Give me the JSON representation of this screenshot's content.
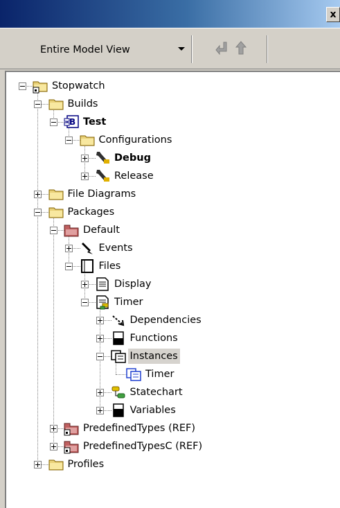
{
  "window": {
    "close_glyph": "x"
  },
  "toolbar": {
    "view_label": "Entire Model View",
    "back_icon": "arrow-down-left-icon",
    "up_icon": "arrow-up-icon"
  },
  "tree": [
    {
      "label": "Stopwatch",
      "icon": "project-folder-icon"
    },
    {
      "label": "Builds",
      "icon": "folder-icon"
    },
    {
      "label": "Test",
      "icon": "build-component-icon",
      "bold": true
    },
    {
      "label": "Configurations",
      "icon": "folder-icon"
    },
    {
      "label": "Debug",
      "icon": "wrench-icon",
      "bold": true
    },
    {
      "label": "Release",
      "icon": "wrench-icon"
    },
    {
      "label": "File Diagrams",
      "icon": "folder-icon"
    },
    {
      "label": "Packages",
      "icon": "folder-icon"
    },
    {
      "label": "Default",
      "icon": "package-icon"
    },
    {
      "label": "Events",
      "icon": "event-icon"
    },
    {
      "label": "Files",
      "icon": "file-list-icon"
    },
    {
      "label": "Display",
      "icon": "file-icon"
    },
    {
      "label": "Timer",
      "icon": "file-with-statechart-icon"
    },
    {
      "label": "Dependencies",
      "icon": "dependency-icon"
    },
    {
      "label": "Functions",
      "icon": "operations-icon"
    },
    {
      "label": "Instances",
      "icon": "instances-icon",
      "selected": true
    },
    {
      "label": "Timer",
      "icon": "instance-icon"
    },
    {
      "label": "Statechart",
      "icon": "statechart-icon"
    },
    {
      "label": "Variables",
      "icon": "variables-icon"
    },
    {
      "label": "PredefinedTypes (REF)",
      "icon": "package-ref-icon"
    },
    {
      "label": "PredefinedTypesC (REF)",
      "icon": "package-ref-icon"
    },
    {
      "label": "Profiles",
      "icon": "folder-icon"
    }
  ]
}
